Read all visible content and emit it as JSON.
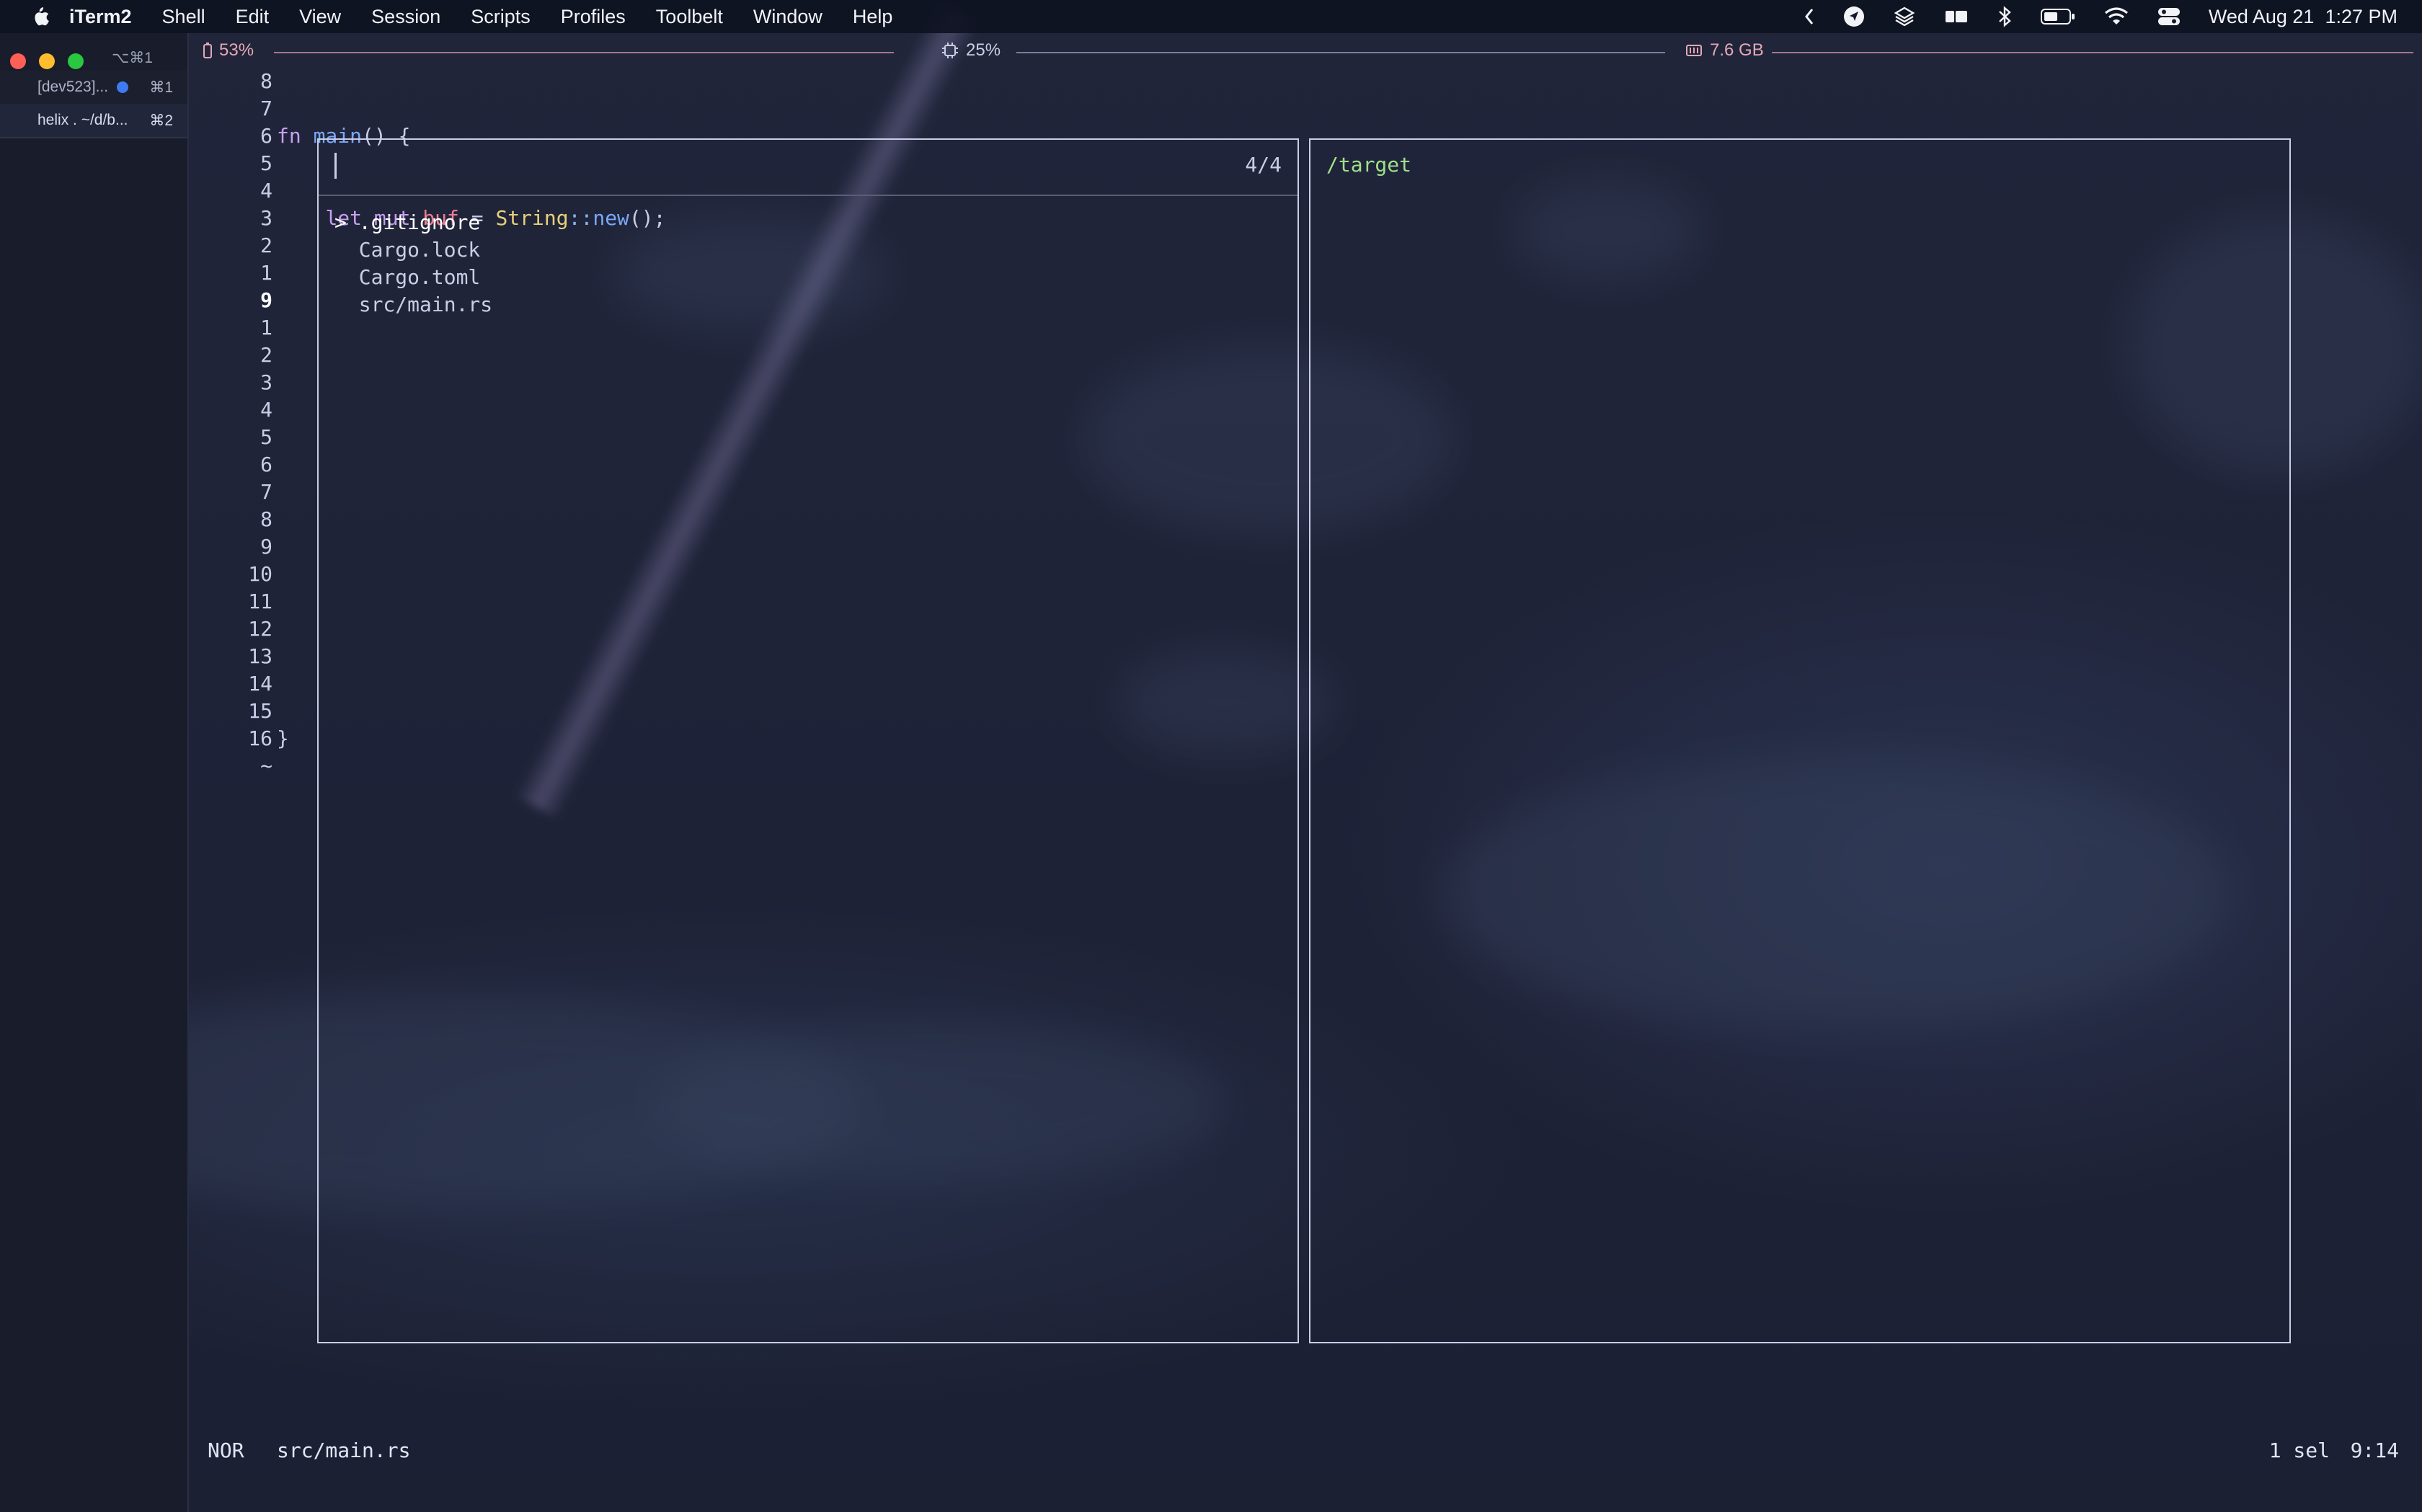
{
  "menubar": {
    "app": "iTerm2",
    "items": [
      "Shell",
      "Edit",
      "View",
      "Session",
      "Scripts",
      "Profiles",
      "Toolbelt",
      "Window",
      "Help"
    ],
    "clock": "Wed Aug 21  1:27 PM"
  },
  "sidebar": {
    "window_shortcut": "⌥⌘1",
    "tabs": [
      {
        "label": "[dev523]...",
        "shortcut": "⌘1",
        "has_activity_dot": true
      },
      {
        "label": "helix . ~/d/b...",
        "shortcut": "⌘2",
        "has_activity_dot": false
      }
    ]
  },
  "stats": {
    "battery": "53%",
    "cpu": "25%",
    "memory": "7.6 GB"
  },
  "editor": {
    "line_numbers": [
      "8",
      "7",
      "6",
      "5",
      "4",
      "3",
      "2",
      "1",
      "9",
      "1",
      "2",
      "3",
      "4",
      "5",
      "6",
      "7",
      "8",
      "9",
      "10",
      "11",
      "12",
      "13",
      "14",
      "15",
      "16",
      "~"
    ],
    "current_line_index": 8,
    "closing_brace": "}"
  },
  "picker": {
    "count": "4/4",
    "items": [
      {
        "label": "> .gitignore",
        "selected": true
      },
      {
        "label": "  Cargo.lock",
        "selected": false
      },
      {
        "label": "  Cargo.toml",
        "selected": false
      },
      {
        "label": "  src/main.rs",
        "selected": false
      }
    ],
    "preview_path": "/target"
  },
  "statusline": {
    "mode": "NOR",
    "file": "src/main.rs",
    "selection": "1 sel",
    "position": "9:14"
  },
  "colors": {
    "keyword": "#c99ef0",
    "function": "#7aa8f7",
    "variable": "#f07d8f",
    "type": "#e8d07a",
    "preview_path": "#9fe08a"
  }
}
